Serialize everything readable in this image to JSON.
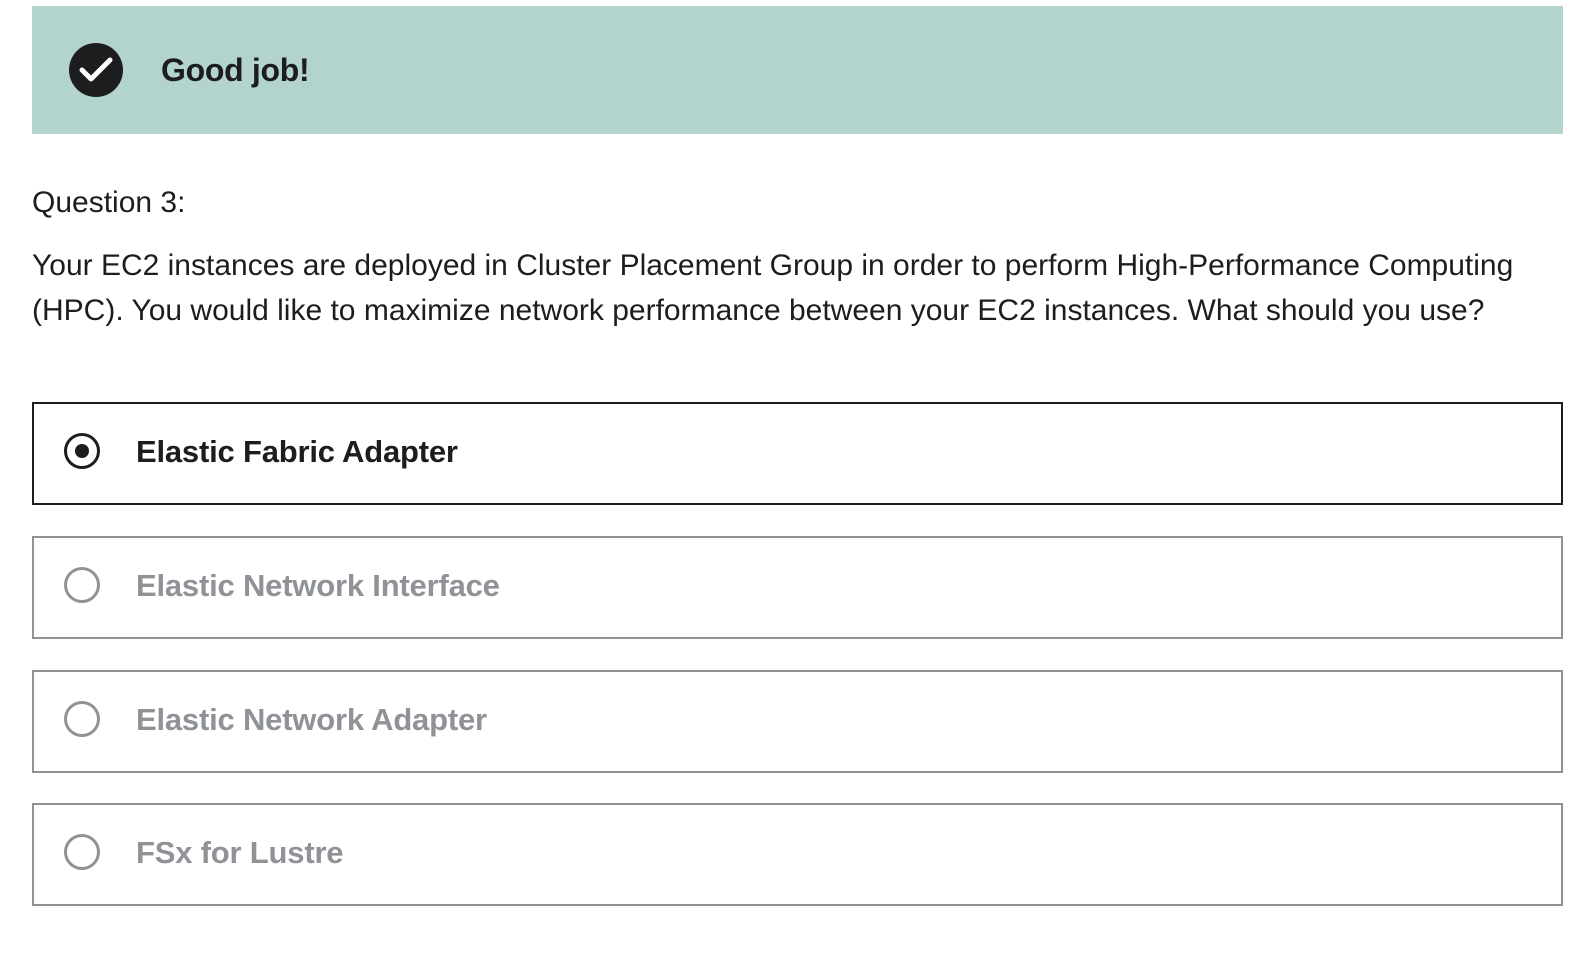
{
  "banner": {
    "icon": "check-circle-icon",
    "message": "Good job!",
    "background_color": "#b3d3cd"
  },
  "question": {
    "number_label": "Question 3:",
    "text": "Your EC2 instances are deployed in Cluster Placement Group in order to perform High-Performance Computing (HPC). You would like to maximize network performance between your EC2 instances. What should you use?"
  },
  "options": [
    {
      "label": "Elastic Fabric Adapter",
      "selected": true
    },
    {
      "label": "Elastic Network Interface",
      "selected": false
    },
    {
      "label": "Elastic Network Adapter",
      "selected": false
    },
    {
      "label": "FSx for Lustre",
      "selected": false
    }
  ],
  "colors": {
    "text_dark": "#1c1d1f",
    "text_muted": "#8f9296",
    "success_banner": "#b3d3cd"
  }
}
